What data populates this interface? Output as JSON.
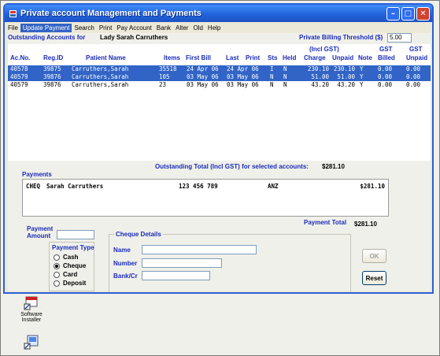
{
  "window": {
    "title": "Private account Management and Payments",
    "controls": {
      "minimize": "–",
      "maximize": "□",
      "close": "✕"
    }
  },
  "menu": {
    "items": [
      "File",
      "Update Payment",
      "Search",
      "Print",
      "Pay Account",
      "Bank",
      "Alter",
      "Old",
      "Help"
    ],
    "active": "Update Payment"
  },
  "header": {
    "outstanding_label": "Outstanding Accounts for",
    "patient_name": "Lady Sarah Carruthers",
    "threshold_label": "Private Billing Threshold ($)",
    "threshold_value": "5.00"
  },
  "table": {
    "group_headers": {
      "incl_gst": "(Incl GST)",
      "gst": "GST",
      "gst2": "GST"
    },
    "columns": [
      "Ac.No.",
      "Reg.ID",
      "Patient Name",
      "Items",
      "First Bill",
      "Last",
      "Print",
      "Sts",
      "Held",
      "Charge",
      "Unpaid",
      "Note",
      "Billed",
      "Unpaid"
    ],
    "rows": [
      {
        "acno": "40578",
        "regid": "39875",
        "name": "Carruthers,Sarah",
        "items": "35518",
        "first": "24 Apr 06",
        "last": "24 Apr 06",
        "sts": "I",
        "held": "N",
        "charge": "230.10",
        "unpaid": "230.10",
        "note": "Y",
        "gst_billed": "0.00",
        "gst_unpaid": "0.00",
        "selected": true
      },
      {
        "acno": "40579",
        "regid": "39876",
        "name": "Carruthers,Sarah",
        "items": "105",
        "first": "03 May 06",
        "last": "03 May 06",
        "sts": "N",
        "held": "N",
        "charge": "51.00",
        "unpaid": "51.00",
        "note": "Y",
        "gst_billed": "0.00",
        "gst_unpaid": "0.00",
        "selected": true
      },
      {
        "acno": "40579",
        "regid": "39876",
        "name": "Carruthers,Sarah",
        "items": "23",
        "first": "03 May 06",
        "last": "03 May 06",
        "sts": "N",
        "held": "N",
        "charge": "43.20",
        "unpaid": "43.20",
        "note": "Y",
        "gst_billed": "0.00",
        "gst_unpaid": "0.00",
        "selected": false
      }
    ]
  },
  "totals": {
    "outstanding_label": "Outstanding Total (Incl GST) for selected accounts:",
    "outstanding_value": "$281.10"
  },
  "payments": {
    "label": "Payments",
    "line": {
      "method": "CHEQ",
      "payer": "Sarah Carruthers",
      "number": "123 456 789",
      "bank": "ANZ",
      "amount": "$281.10"
    },
    "total_label": "Payment Total",
    "total_value": "$281.10"
  },
  "payment_form": {
    "amount_label": "Payment Amount",
    "amount_value": "",
    "type_title": "Payment Type",
    "types": [
      {
        "label": "Cash",
        "checked": false
      },
      {
        "label": "Cheque",
        "checked": true
      },
      {
        "label": "Card",
        "checked": false
      },
      {
        "label": "Deposit",
        "checked": false
      }
    ],
    "cheque_title": "Cheque Details",
    "name_label": "Name",
    "number_label": "Number",
    "bank_label": "Bank/Cr",
    "name_value": "",
    "number_value": "",
    "bank_value": ""
  },
  "buttons": {
    "ok": "OK",
    "reset": "Reset"
  },
  "desktop": {
    "icon1_label": "Software Installer",
    "icon2_label": ""
  }
}
